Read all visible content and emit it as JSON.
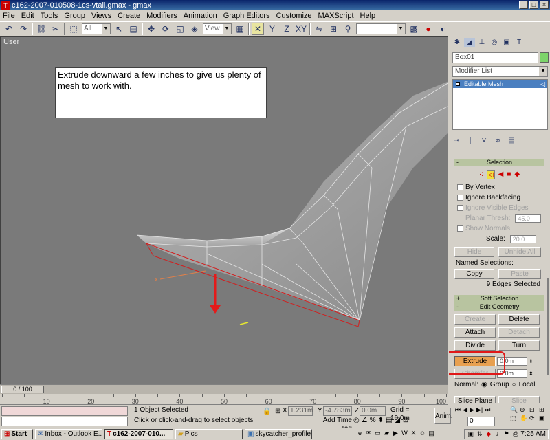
{
  "window": {
    "title": "c162-2007-010508-1cs-vtail.gmax - gmax",
    "buttons": [
      "_",
      "□",
      "×"
    ]
  },
  "menu": [
    "File",
    "Edit",
    "Tools",
    "Group",
    "Views",
    "Create",
    "Modifiers",
    "Animation",
    "Graph Editors",
    "Customize",
    "MAXScript",
    "Help"
  ],
  "toolbar": {
    "selection_filter": "All",
    "coord_system": "View"
  },
  "viewport": {
    "label": "User",
    "note": "Extrude downward a few inches to give us plenty of mesh to work with."
  },
  "panel": {
    "object_name": "Box01",
    "object_color": "#7cd46a",
    "modifier_list": "Modifier List",
    "stack_item": "Editable Mesh",
    "selection": {
      "title": "Selection",
      "by_vertex": "By Vertex",
      "ignore_backfacing": "Ignore Backfacing",
      "ignore_visible_edges": "Ignore Visible Edges",
      "planar_thresh_label": "Planar Thresh:",
      "planar_thresh_value": "45.0",
      "show_normals": "Show Normals",
      "scale_label": "Scale:",
      "scale_value": "20.0",
      "hide": "Hide",
      "unhide_all": "Unhide All",
      "named_selections": "Named Selections:",
      "copy": "Copy",
      "paste": "Paste",
      "status": "9 Edges Selected"
    },
    "soft_selection": "Soft Selection",
    "edit_geometry": {
      "title": "Edit Geometry",
      "create": "Create",
      "delete": "Delete",
      "attach": "Attach",
      "detach": "Detach",
      "divide": "Divide",
      "turn": "Turn",
      "extrude": "Extrude",
      "extrude_value": "0.0m",
      "chamfer": "Chamfer",
      "chamfer_value": "0.0m",
      "normal_label": "Normal:",
      "group": "Group",
      "local": "Local",
      "slice_plane": "Slice Plane",
      "slice": "Slice"
    }
  },
  "timeline": {
    "frame": "0 / 100",
    "ticks": [
      "10",
      "20",
      "30",
      "40",
      "50",
      "60",
      "70",
      "80",
      "90",
      "100"
    ]
  },
  "status": {
    "objects_selected": "1 Object Selected",
    "prompt": "Click or click-and-drag to select objects",
    "x_label": "X",
    "x_value": "1.231m",
    "y_label": "Y",
    "y_value": "-4.783m",
    "z_label": "Z",
    "z_value": "0.0m",
    "grid": "Grid = 10.0m",
    "add_time_tag": "Add Time Tag",
    "anim": "Anim.",
    "frame_field": "0"
  },
  "taskbar": {
    "start": "Start",
    "tasks": [
      "Inbox - Outlook E...",
      "c162-2007-010...",
      "Pics",
      "skycatcher_profile...."
    ],
    "clock": "7:25 AM"
  }
}
